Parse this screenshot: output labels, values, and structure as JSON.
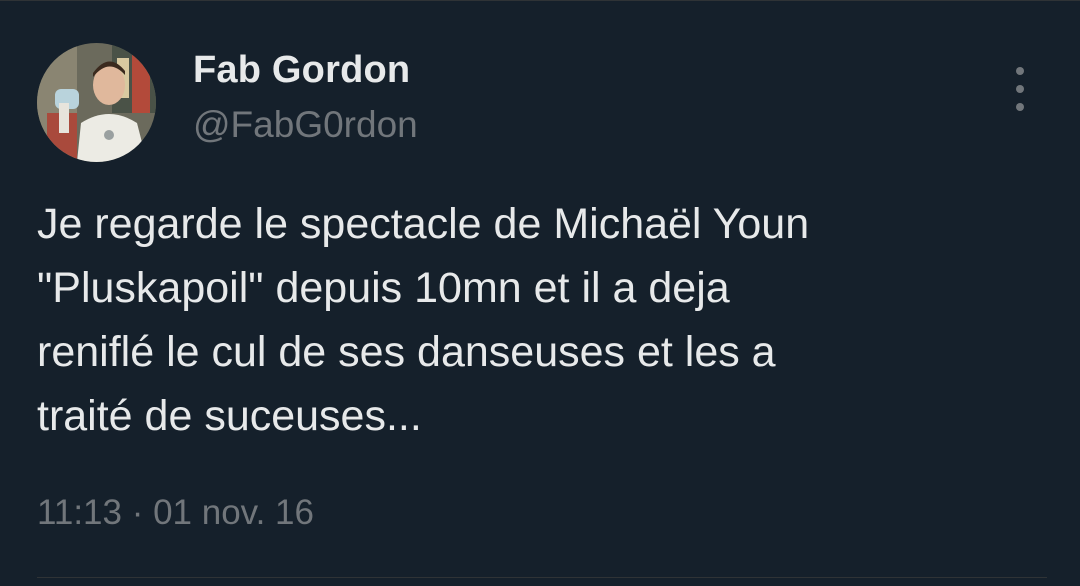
{
  "tweet": {
    "author": {
      "display_name": "Fab Gordon",
      "handle": "@FabG0rdon"
    },
    "text_lines": [
      "Je regarde le spectacle de Michaël Youn",
      "\"Pluskapoil\" depuis 10mn et il a deja",
      "reniflé le cul de ses danseuses et les a",
      "traité de suceuses..."
    ],
    "timestamp": "11:13 · 01 nov. 16"
  },
  "colors": {
    "background": "#15202b",
    "primary_text": "#e7e9ea",
    "secondary_text": "#71767b",
    "divider": "#2f3336"
  },
  "icons": {
    "more": "more-vertical-icon"
  }
}
